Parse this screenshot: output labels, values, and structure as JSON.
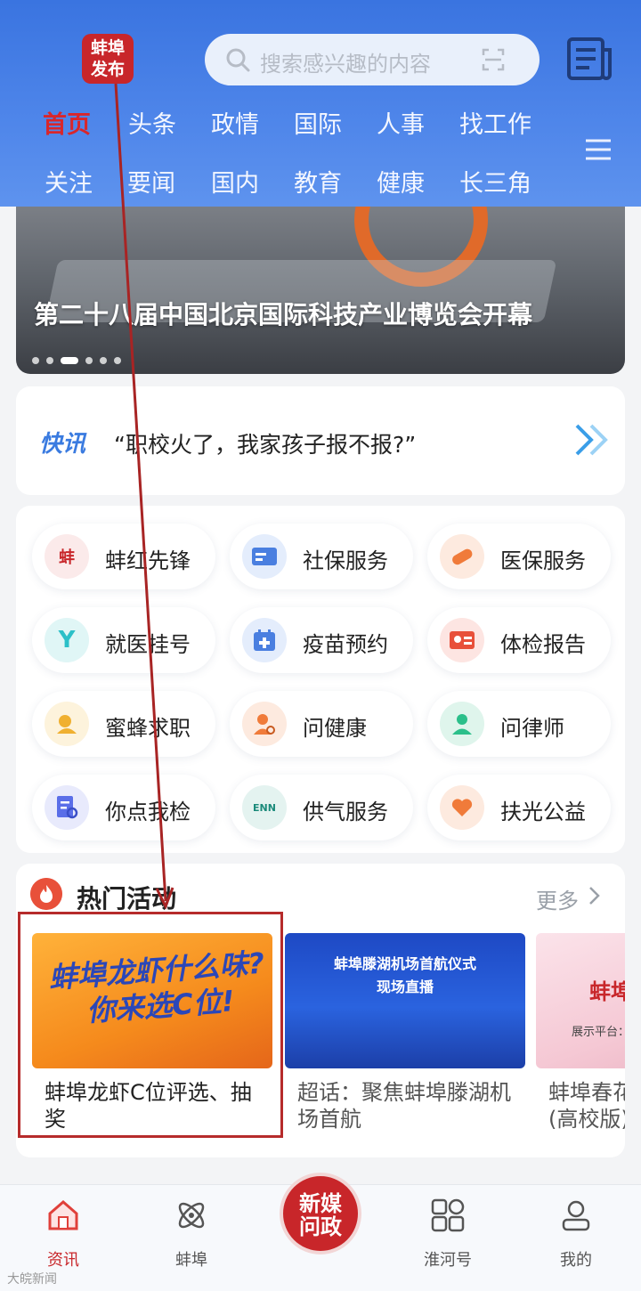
{
  "header": {
    "logo_line1": "蚌埠",
    "logo_line2": "发布",
    "search_placeholder": "搜索感兴趣的内容",
    "tabs_row1": [
      "首页",
      "头条",
      "政情",
      "国际",
      "人事",
      "找工作"
    ],
    "tabs_row2": [
      "关注",
      "要闻",
      "国内",
      "教育",
      "健康",
      "长三角"
    ],
    "active_tab": "首页"
  },
  "banner": {
    "caption": "第二十八届中国北京国际科技产业博览会开幕",
    "slide_count": 6,
    "active_slide": 3
  },
  "flash": {
    "tag": "快讯",
    "text": "“职校火了，我家孩子报不报?”"
  },
  "services": [
    {
      "label": "蚌红先锋",
      "icon": "bang-hong-logo-icon",
      "color": "#c8262a"
    },
    {
      "label": "社保服务",
      "icon": "social-security-card-icon",
      "color": "#4a7fe0"
    },
    {
      "label": "医保服务",
      "icon": "pill-icon",
      "color": "#f07b3a"
    },
    {
      "label": "就医挂号",
      "icon": "y-hospital-icon",
      "color": "#2bc0c8"
    },
    {
      "label": "疫苗预约",
      "icon": "calendar-plus-icon",
      "color": "#4a7fe0"
    },
    {
      "label": "体检报告",
      "icon": "id-card-icon",
      "color": "#e8503a"
    },
    {
      "label": "蜜蜂求职",
      "icon": "bee-job-icon",
      "color": "#f0b030"
    },
    {
      "label": "问健康",
      "icon": "doctor-search-icon",
      "color": "#f07b3a"
    },
    {
      "label": "问律师",
      "icon": "lawyer-icon",
      "color": "#2bbf8a"
    },
    {
      "label": "你点我检",
      "icon": "inspect-document-icon",
      "color": "#5a6ee8"
    },
    {
      "label": "供气服务",
      "icon": "enn-gas-logo-icon",
      "color": "#1a8a7a"
    },
    {
      "label": "扶光公益",
      "icon": "charity-heart-icon",
      "color": "#f07b3a"
    }
  ],
  "hot": {
    "title": "热门活动",
    "more": "更多",
    "cards": [
      {
        "title": "蚌埠龙虾C位评选、抽奖",
        "thumb_line1": "蚌埠龙虾什么味?",
        "thumb_line2": "你来选C位!"
      },
      {
        "title": "超话：聚焦蚌埠滕湖机场首航",
        "thumb_line1": "蚌埠滕湖机场首航仪式",
        "thumb_line2": "现场直播"
      },
      {
        "title": "蚌埠春花(高校版)",
        "thumb_line1": "蚌埠",
        "thumb_line2": "展示平台：蚌埠"
      }
    ]
  },
  "bottom_nav": {
    "items": [
      "资讯",
      "蚌埠",
      "淮河号",
      "我的"
    ],
    "active": "资讯",
    "center_line1": "新媒",
    "center_line2": "问政"
  },
  "watermark": "大皖新闻"
}
